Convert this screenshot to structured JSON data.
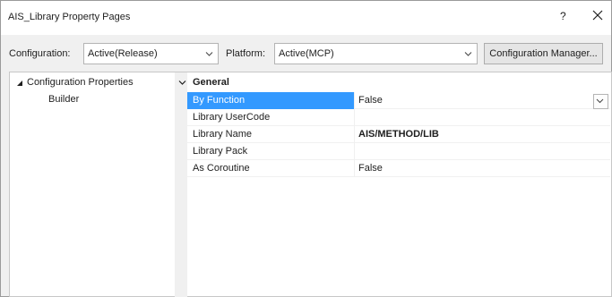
{
  "window": {
    "title": "AIS_Library Property Pages",
    "help": "?",
    "close_icon": "close-icon"
  },
  "toolbar": {
    "configuration_label": "Configuration:",
    "configuration_value": "Active(Release)",
    "platform_label": "Platform:",
    "platform_value": "Active(MCP)",
    "config_manager_label": "Configuration Manager..."
  },
  "tree": {
    "root": {
      "label": "Configuration Properties",
      "expanded": true
    },
    "child": {
      "label": "Builder",
      "selected": true
    }
  },
  "grid": {
    "section": {
      "label": "General",
      "expanded": true
    },
    "rows": [
      {
        "name": "By Function",
        "value": "False",
        "selected": true,
        "has_dropdown": true
      },
      {
        "name": "Library UserCode",
        "value": ""
      },
      {
        "name": "Library Name",
        "value": "AIS/METHOD/LIB",
        "bold": true
      },
      {
        "name": "Library Pack",
        "value": ""
      },
      {
        "name": "As Coroutine",
        "value": "False"
      }
    ]
  },
  "colors": {
    "selection": "#3399ff",
    "window_bg": "#f0f0f0"
  }
}
